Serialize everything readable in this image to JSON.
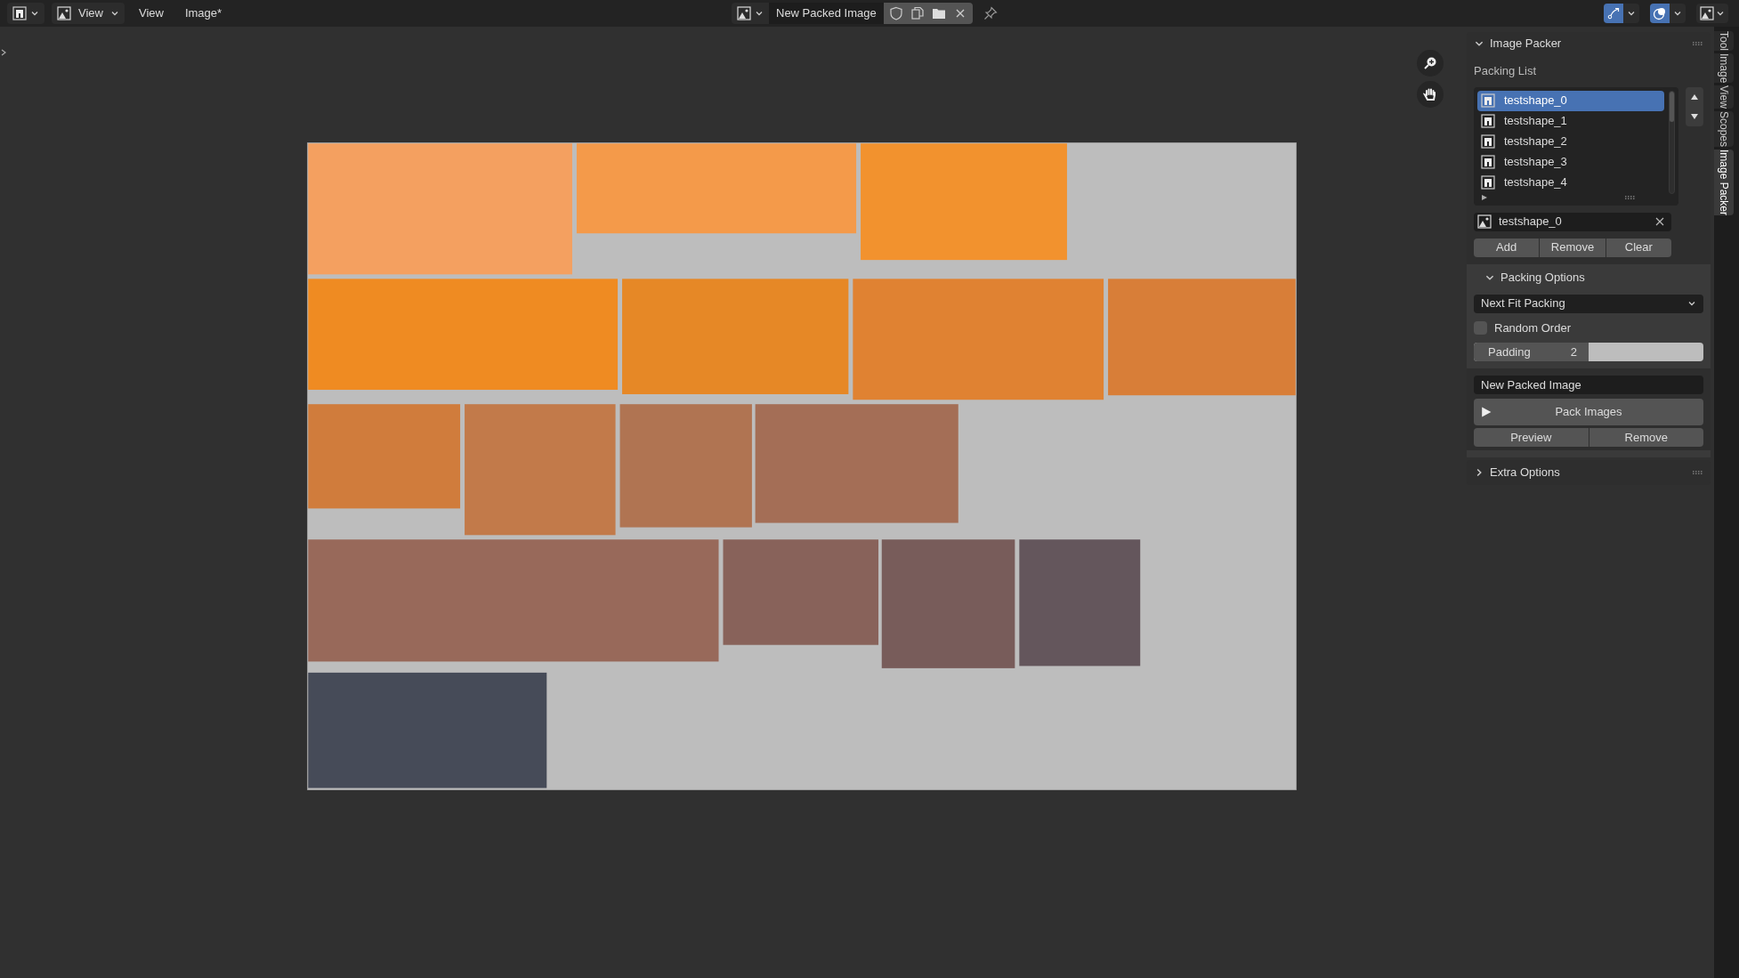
{
  "header": {
    "editor_label": "View",
    "menus": [
      "View",
      "Image*"
    ],
    "image_name": "New Packed Image",
    "viewport_toggles": [
      {
        "kind": "gizmo",
        "on": true
      },
      {
        "kind": "overlay",
        "on": true
      }
    ]
  },
  "panel": {
    "title": "Image Packer",
    "expanded": true,
    "packing_list_label": "Packing List",
    "items": [
      {
        "name": "testshape_0",
        "selected": true
      },
      {
        "name": "testshape_1",
        "selected": false
      },
      {
        "name": "testshape_2",
        "selected": false
      },
      {
        "name": "testshape_3",
        "selected": false
      },
      {
        "name": "testshape_4",
        "selected": false
      }
    ],
    "active_image": "testshape_0",
    "list_buttons": [
      "Add",
      "Remove",
      "Clear"
    ],
    "packing_options": {
      "title": "Packing Options",
      "expanded": true,
      "method": "Next Fit Packing",
      "random_order": {
        "label": "Random Order",
        "checked": false
      },
      "padding": {
        "label": "Padding",
        "value": "2",
        "level": 0.5
      }
    },
    "output_name": "New Packed Image",
    "pack_button": "Pack Images",
    "action_buttons": [
      "Preview",
      "Remove"
    ]
  },
  "extra_options": {
    "title": "Extra Options",
    "expanded": false
  },
  "side_tabs": [
    {
      "label": "Tool",
      "selected": false
    },
    {
      "label": "Image",
      "selected": false
    },
    {
      "label": "View",
      "selected": false
    },
    {
      "label": "Scopes",
      "selected": false
    },
    {
      "label": "Image Packer",
      "selected": true
    }
  ]
}
